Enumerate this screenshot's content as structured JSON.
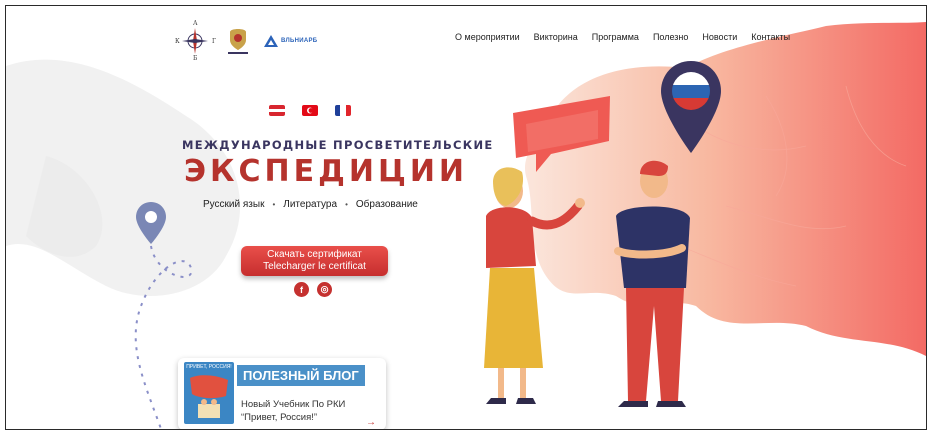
{
  "nav": {
    "items": [
      "О мероприятии",
      "Викторина",
      "Программа",
      "Полезно",
      "Новости",
      "Контакты"
    ]
  },
  "logos": {
    "compass_n": "А",
    "compass_s": "Б",
    "compass_w": "К",
    "compass_e": "Г",
    "partner_text": "ВЛЬНИАРБ"
  },
  "flags": [
    {
      "name": "austria",
      "colors": [
        "#d8262f",
        "#ffffff",
        "#d8262f"
      ]
    },
    {
      "name": "turkey",
      "colors": [
        "#e30a17"
      ]
    },
    {
      "name": "france",
      "colors": [
        "#1f3f99",
        "#ffffff",
        "#e1252b"
      ]
    }
  ],
  "hero": {
    "title_top": "МЕЖДУНАРОДНЫЕ ПРОСВЕТИТЕЛЬСКИЕ",
    "title_main": "ЭКСПЕДИЦИИ",
    "subtitle": [
      "Русский язык",
      "Литература",
      "Образование"
    ],
    "cert_line1": "Скачать сертификат",
    "cert_line2": "Telecharger le certificat"
  },
  "social": {
    "facebook": "f",
    "instagram": "◎"
  },
  "blog": {
    "book_title": "ПРИВЕТ, РОССИЯ!",
    "tag": "ПОЛЕЗНЫЙ БЛОГ",
    "line1": "Новый Учебник По РКИ",
    "line2": "“Привет, Россия!”",
    "arrow": "→"
  },
  "colors": {
    "accent": "#c5312f",
    "title_dark": "#3a3560",
    "blue": "#4a90c8",
    "map_peach": "#f7b8a0",
    "map_red": "#f47268"
  }
}
